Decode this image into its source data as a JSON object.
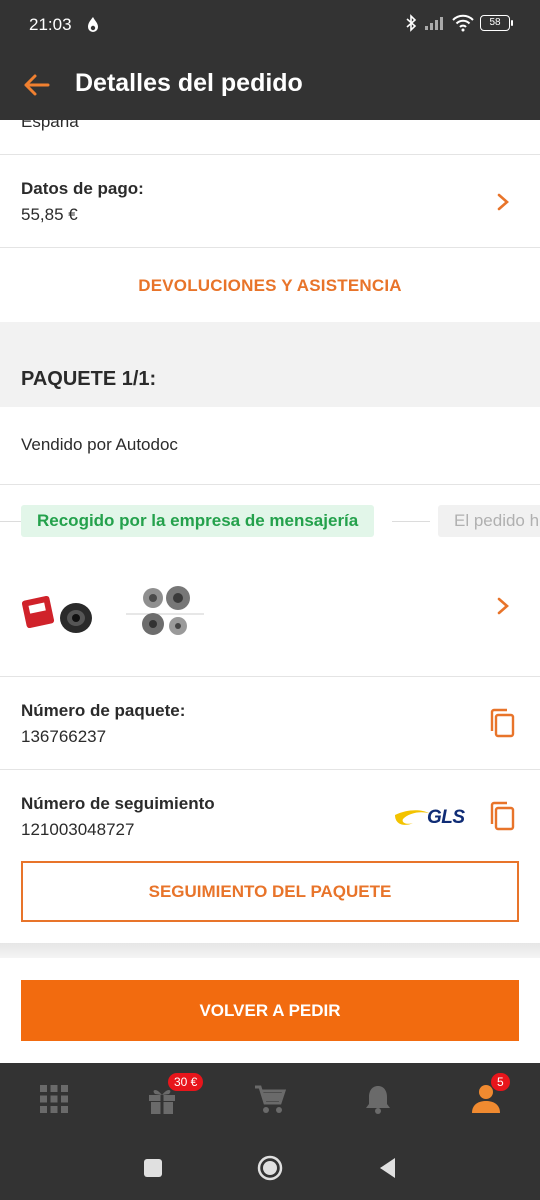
{
  "status_bar": {
    "time": "21:03",
    "battery": "58"
  },
  "app_bar": {
    "title": "Detalles del pedido"
  },
  "address": {
    "country": "España"
  },
  "payment": {
    "label": "Datos de pago:",
    "amount": "55,85 €"
  },
  "returns": {
    "label": "DEVOLUCIONES Y ASISTENCIA"
  },
  "package": {
    "header": "PAQUETE 1/1:",
    "sold_by": "Vendido por Autodoc",
    "status_active": "Recogido por la empresa de mensajería",
    "status_next": "El pedido h",
    "number_label": "Número de paquete:",
    "number_value": "136766237",
    "tracking_label": "Número de seguimiento",
    "tracking_value": "121003048727",
    "carrier": "GLS",
    "tracking_button": "SEGUIMIENTO DEL PAQUETE"
  },
  "reorder_button": "VOLVER A PEDIR",
  "bottom_nav": {
    "gift_badge": "30 €",
    "profile_badge": "5"
  },
  "colors": {
    "accent": "#f26b0f",
    "bar": "#333333",
    "success": "#24a14c"
  }
}
